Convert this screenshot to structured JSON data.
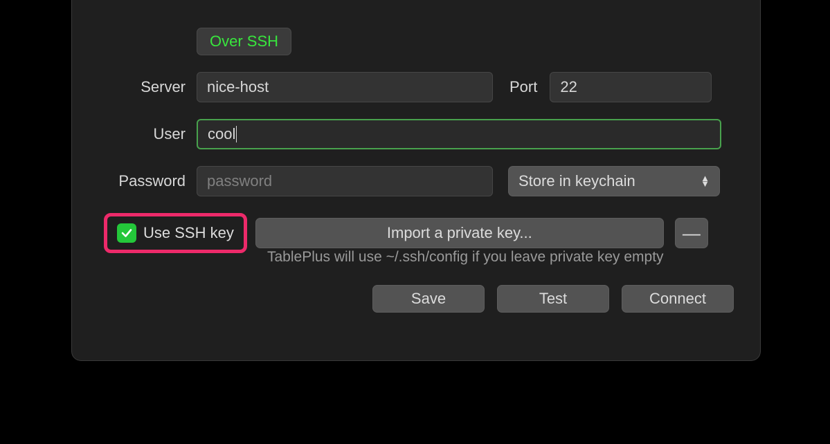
{
  "over_ssh_label": "Over SSH",
  "server": {
    "label": "Server",
    "value": "nice-host"
  },
  "port": {
    "label": "Port",
    "value": "22"
  },
  "user": {
    "label": "User",
    "value": "cool"
  },
  "password": {
    "label": "Password",
    "placeholder": "password",
    "store_option": "Store in keychain"
  },
  "ssh_key": {
    "checkbox_label": "Use SSH key",
    "import_label": "Import a private key...",
    "hint": "TablePlus will use ~/.ssh/config if you leave private key empty"
  },
  "buttons": {
    "save": "Save",
    "test": "Test",
    "connect": "Connect",
    "minus": "—"
  }
}
